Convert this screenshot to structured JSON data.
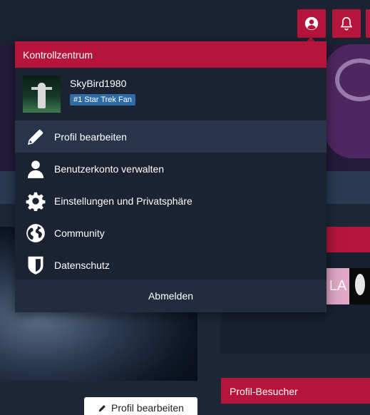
{
  "topbar": {
    "account_icon": "user-circle-icon",
    "notifications_icon": "bell-icon"
  },
  "background": {
    "banner_text": "LA",
    "visitors_heading": "Profil-Besucher",
    "edit_profile_button": "Profil bearbeiten"
  },
  "dropdown": {
    "title": "Kontrollzentrum",
    "user": {
      "name": "SkyBird1980",
      "rank": "#1 Star Trek Fan"
    },
    "items": [
      {
        "label": "Profil bearbeiten",
        "icon": "pencil-icon"
      },
      {
        "label": "Benutzerkonto verwalten",
        "icon": "user-icon"
      },
      {
        "label": "Einstellungen und Privatsphäre",
        "icon": "gear-icon"
      },
      {
        "label": "Community",
        "icon": "globe-icon"
      },
      {
        "label": "Datenschutz",
        "icon": "shield-icon"
      }
    ],
    "logout": "Abmelden"
  },
  "colors": {
    "accent": "#b5153b",
    "panel": "#1b2232",
    "badge": "#2f6ca6"
  }
}
